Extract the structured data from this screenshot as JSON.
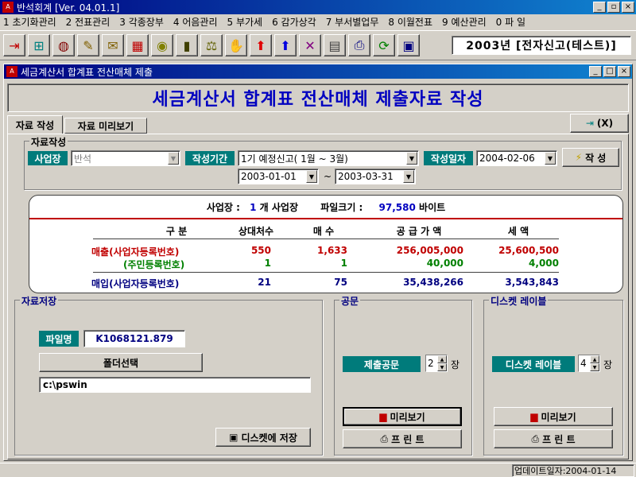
{
  "app": {
    "title": "반석회계 [Ver. 04.01.1]"
  },
  "menu": [
    "1 초기화관리",
    "2 전표관리",
    "3 각종장부",
    "4 어음관리",
    "5 부가세",
    "6 감가상각",
    "7 부서별업무",
    "8 이월전표",
    "9 예산관리",
    "0 파 일"
  ],
  "company_label": "2003년 [전자신고(테스트)]",
  "window": {
    "title": "세금계산서 합계표 전산매체 제출"
  },
  "header_title": "세금계산서 합계표 전산매체 제출자료 작성",
  "tabs": [
    "자료 작성",
    "자료 미리보기"
  ],
  "exit_label": "(X)",
  "form": {
    "group_label": "자료작성",
    "site_label": "사업장",
    "site_value": "반석",
    "period_label": "작성기간",
    "period_value": "1기 예정신고( 1월 ~ 3월)",
    "date_label": "작성일자",
    "date_value": "2004-02-06",
    "create_label": "작 성",
    "from_date": "2003-01-01",
    "tilde": "~",
    "to_date": "2003-03-31"
  },
  "summary": {
    "site_count_label": "사업장 :",
    "site_count": "1",
    "site_count_unit": "개 사업장",
    "filesize_label": "파일크기 :",
    "filesize": "97,580",
    "filesize_unit": "바이트",
    "headers": [
      "구 분",
      "상대처수",
      "매 수",
      "공 급 가 액",
      "세 액"
    ],
    "rows": [
      {
        "label": "매출(사업자등록번호)",
        "c1": "550",
        "c2": "1,633",
        "c3": "256,005,000",
        "c4": "25,600,500"
      },
      {
        "label": "(주민등록번호)",
        "c1": "1",
        "c2": "1",
        "c3": "40,000",
        "c4": "4,000"
      },
      {
        "label": "매입(사업자등록번호)",
        "c1": "21",
        "c2": "75",
        "c3": "35,438,266",
        "c4": "3,543,843"
      }
    ]
  },
  "save": {
    "group_label": "자료저장",
    "filename_label": "파일명",
    "filename": "K1068121.879",
    "folder_button": "폴더선택",
    "path": "c:\\pswin",
    "save_button": "디스켓에 저장"
  },
  "letter": {
    "group_label": "공문",
    "label": "제출공문",
    "count": "2",
    "unit": "장",
    "preview": "미리보기",
    "print": "프 린 트"
  },
  "disk": {
    "group_label": "디스켓 레이블",
    "label": "디스켓 레이블",
    "count": "4",
    "unit": "장",
    "preview": "미리보기",
    "print": "프 린 트"
  },
  "status": {
    "update": "업데이트일자:2004-01-14"
  },
  "colors": {
    "title_bar": "#000080",
    "header_text": "#0000c0",
    "teal": "#007b7b",
    "sales": "#c00000",
    "resident": "#008000",
    "purchase": "#000080"
  }
}
